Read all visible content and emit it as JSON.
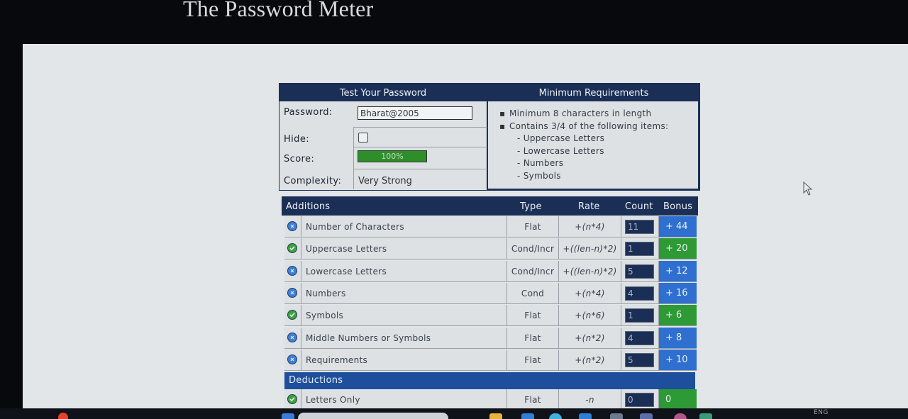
{
  "site_title": "The Password Meter",
  "panel": {
    "test_heading": "Test Your Password",
    "requirements_heading": "Minimum Requirements",
    "password_label": "Password:",
    "password_value": "Bharat@2005",
    "hide_label": "Hide:",
    "hide_checked": false,
    "score_label": "Score:",
    "score_text": "100%",
    "score_fraction": 1.0,
    "complexity_label": "Complexity:",
    "complexity_value": "Very Strong",
    "requirements": [
      "Minimum 8 characters in length",
      "Contains 3/4 of the following items:"
    ],
    "requirement_items": [
      "- Uppercase Letters",
      "- Lowercase Letters",
      "- Numbers",
      "- Symbols"
    ]
  },
  "table": {
    "headers": {
      "additions": "Additions",
      "type": "Type",
      "rate": "Rate",
      "count": "Count",
      "bonus": "Bonus"
    },
    "additions": [
      {
        "name": "Number of Characters",
        "type": "Flat",
        "rate": "+(n*4)",
        "count": "11",
        "bonus": "+ 44",
        "status": "excess"
      },
      {
        "name": "Uppercase Letters",
        "type": "Cond/Incr",
        "rate": "+((len-n)*2)",
        "count": "1",
        "bonus": "+ 20",
        "status": "pass"
      },
      {
        "name": "Lowercase Letters",
        "type": "Cond/Incr",
        "rate": "+((len-n)*2)",
        "count": "5",
        "bonus": "+ 12",
        "status": "excess"
      },
      {
        "name": "Numbers",
        "type": "Cond",
        "rate": "+(n*4)",
        "count": "4",
        "bonus": "+ 16",
        "status": "excess"
      },
      {
        "name": "Symbols",
        "type": "Flat",
        "rate": "+(n*6)",
        "count": "1",
        "bonus": "+ 6",
        "status": "pass"
      },
      {
        "name": "Middle Numbers or Symbols",
        "type": "Flat",
        "rate": "+(n*2)",
        "count": "4",
        "bonus": "+ 8",
        "status": "excess"
      },
      {
        "name": "Requirements",
        "type": "Flat",
        "rate": "+(n*2)",
        "count": "5",
        "bonus": "+ 10",
        "status": "excess"
      }
    ],
    "deductions_heading": "Deductions",
    "deductions": [
      {
        "name": "Letters Only",
        "type": "Flat",
        "rate": "-n",
        "count": "0",
        "bonus": "0",
        "status": "pass"
      }
    ]
  },
  "taskbar": {
    "language": "ENG"
  },
  "colors": {
    "header_navy": "#1b2f56",
    "bonus_blue": "#2f6fd0",
    "bonus_green": "#2e9a35",
    "deductions_blue": "#1e4f9c",
    "score_green": "#2e8f2a"
  }
}
